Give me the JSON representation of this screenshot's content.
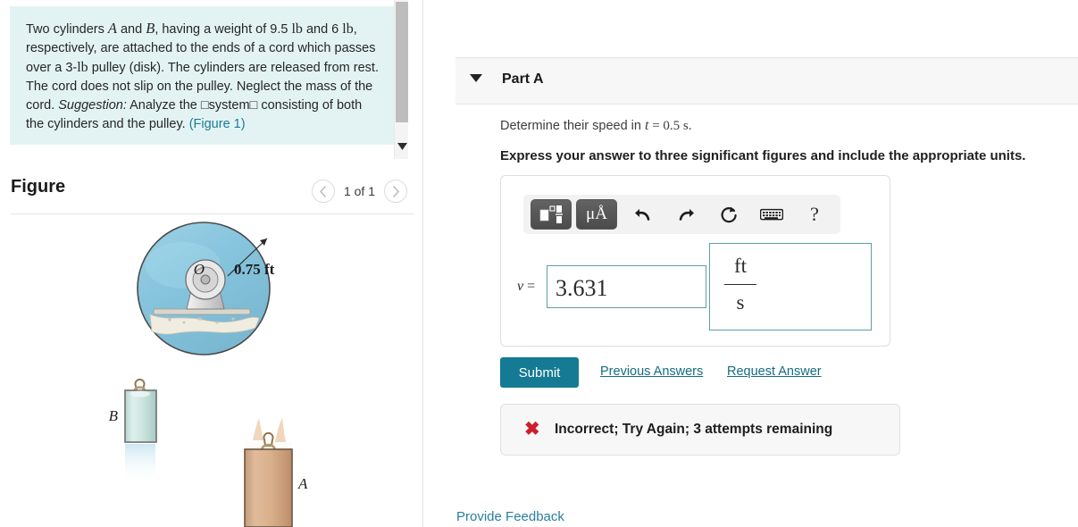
{
  "question": {
    "text_line1": "Two cylinders ",
    "var_a": "A",
    "and_text": " and ",
    "var_b": "B",
    "text_mid1": ", having a weight of 9.5 ",
    "unit_lb1": "lb",
    "text_mid2": "and 6 ",
    "unit_lb2": "lb",
    "text_mid3": ", respectively, are attached to the ends of a cord which passes over a 3-",
    "unit_lb3": "lb",
    "text_mid4": " pulley (disk). The cylinders are released from rest. The cord does not slip on the pulley. Neglect the mass of the cord. ",
    "suggestion_label": "Suggestion:",
    "suggestion_text": " Analyze the □system□ consisting of both the cylinders and the pulley. ",
    "figure_link": "(Figure 1)"
  },
  "figure": {
    "title": "Figure",
    "counter": "1 of 1",
    "prev_icon": "chevron-left-icon",
    "next_icon": "chevron-right-icon",
    "radius_label": "0.75 ft",
    "center_label": "O",
    "cylinder_a_label": "A",
    "cylinder_b_label": "B",
    "disk_color": "#85c2db",
    "cylinder_a_color": "#d3a77f",
    "cylinder_b_color": "#c2ded9"
  },
  "part": {
    "caret_icon": "caret-down-icon",
    "title": "Part A",
    "prompt_pre": "Determine their speed in ",
    "prompt_var": "t",
    "prompt_post": " = 0.5 s.",
    "instruction": "Express your answer to three significant figures and include the appropriate units."
  },
  "toolbar": {
    "template_icon": "math-template-icon",
    "units_label": "μÅ",
    "units_icon": "units-micro-angstrom-icon",
    "undo_icon": "undo-arrow-icon",
    "redo_icon": "redo-arrow-icon",
    "reset_icon": "reset-circular-arrow-icon",
    "keyboard_icon": "keyboard-icon",
    "help_label": "?",
    "help_icon": "question-mark-icon"
  },
  "answer": {
    "label_var": "v",
    "label_eq": " =",
    "value": "3.631",
    "placeholder": "",
    "unit_numerator": "ft",
    "unit_denominator": "s"
  },
  "actions": {
    "submit_label": "Submit",
    "previous_answers_label": "Previous Answers",
    "request_answer_label": "Request Answer"
  },
  "feedback": {
    "status_icon": "x-mark-icon",
    "status_symbol": "✖",
    "message": "Incorrect; Try Again; 3 attempts remaining",
    "error_color": "#cc1f2d"
  },
  "footer": {
    "provide_feedback_label": "Provide Feedback"
  },
  "theme": {
    "accent": "#157a93",
    "link": "#1b7b94",
    "question_bg": "#e3f3f3",
    "band_bg": "#f7f7f7"
  }
}
